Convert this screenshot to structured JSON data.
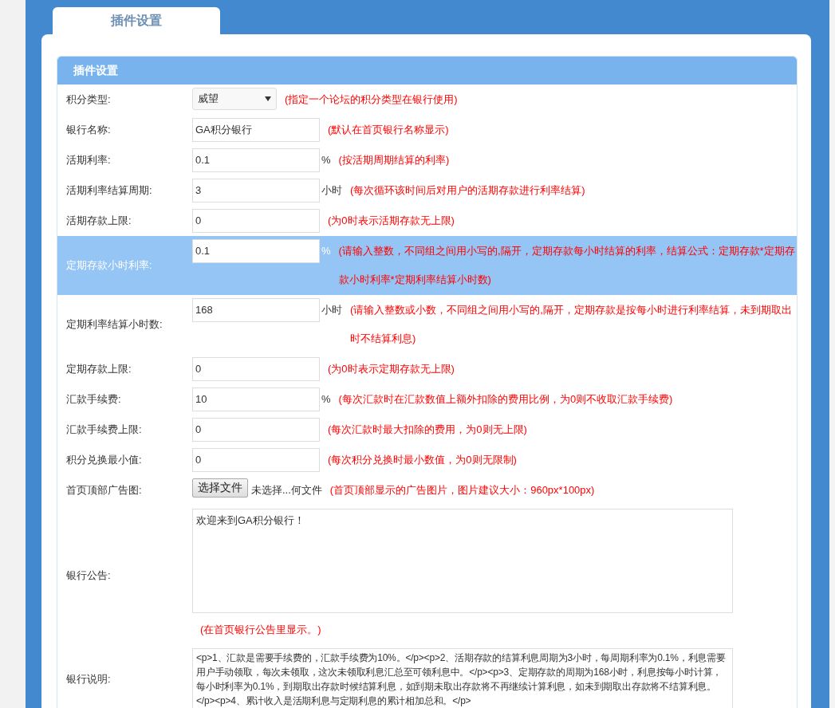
{
  "tab": {
    "label": "插件设置",
    "selected": true
  },
  "panel": {
    "title": "插件设置"
  },
  "rows": [
    {
      "kind": "select",
      "label": "积分类型:",
      "value": "威望",
      "hint": "(指定一个论坛的积分类型在银行使用)",
      "highlighted": false
    },
    {
      "kind": "text",
      "label": "银行名称:",
      "value": "GA积分银行",
      "hint": "(默认在首页银行名称显示)",
      "highlighted": false
    },
    {
      "kind": "text",
      "label": "活期利率:",
      "value": "0.1",
      "unit": "%",
      "hint": "(按活期周期结算的利率)",
      "highlighted": false
    },
    {
      "kind": "text",
      "label": "活期利率结算周期:",
      "value": "3",
      "unit": "小时",
      "hint": "(每次循环该时间后对用户的活期存款进行利率结算)",
      "highlighted": false
    },
    {
      "kind": "text",
      "label": "活期存款上限:",
      "value": "0",
      "hint": "(为0时表示活期存款无上限)",
      "highlighted": false
    },
    {
      "kind": "text",
      "label": "定期存款小时利率:",
      "value": "0.1",
      "unit": "%",
      "hint": "(请输入整数，不同组之间用小写的,隔开，定期存款每小时结算的利率，结算公式：定期存款*定期存款小时利率*定期利率结算小时数)",
      "highlighted": true
    },
    {
      "kind": "text",
      "label": "定期利率结算小时数:",
      "value": "168",
      "unit": "小时",
      "hint": "(请输入整数或小数，不同组之间用小写的,隔开，定期存款是按每小时进行利率结算，未到期取出时不结算利息)",
      "highlighted": false
    },
    {
      "kind": "text",
      "label": "定期存款上限:",
      "value": "0",
      "hint": "(为0时表示定期存款无上限)",
      "highlighted": false
    },
    {
      "kind": "text",
      "label": "汇款手续费:",
      "value": "10",
      "unit": "%",
      "hint": "(每次汇款时在汇款数值上额外扣除的费用比例，为0则不收取汇款手续费)",
      "highlighted": false
    },
    {
      "kind": "text",
      "label": "汇款手续费上限:",
      "value": "0",
      "hint": "(每次汇款时最大扣除的费用，为0则无上限)",
      "highlighted": false
    },
    {
      "kind": "text",
      "label": "积分兑换最小值:",
      "value": "0",
      "hint": "(每次积分兑换时最小数值，为0则无限制)",
      "highlighted": false
    },
    {
      "kind": "file",
      "label": "首页顶部广告图:",
      "button": "选择文件",
      "value": "未选择...何文件",
      "hint": "(首页顶部显示的广告图片，图片建议大小：960px*100px)",
      "highlighted": false
    },
    {
      "kind": "textarea",
      "label": "银行公告:",
      "value": "欢迎来到GA积分银行！",
      "hint": "(在首页银行公告里显示。)",
      "highlighted": false
    },
    {
      "kind": "textarea",
      "label": "银行说明:",
      "value": "<p>1、汇款是需要手续费的，汇款手续费为10%。</p><p>2、活期存款的结算利息周期为3小时，每周期利率为0.1%，利息需要用户手动领取，每次未领取，这次未领取利息汇总至可领利息中。</p><p>3、定期存款的周期为168小时，利息按每小时计算，每小时利率为0.1%，到期取出存款时候结算利息，如到期未取出存款将不再继续计算利息，如未到期取出存款将不结算利息。</p><p>4、累计收入是活期利息与定期利息的累计相加总和。</p>",
      "highlighted": false
    }
  ]
}
